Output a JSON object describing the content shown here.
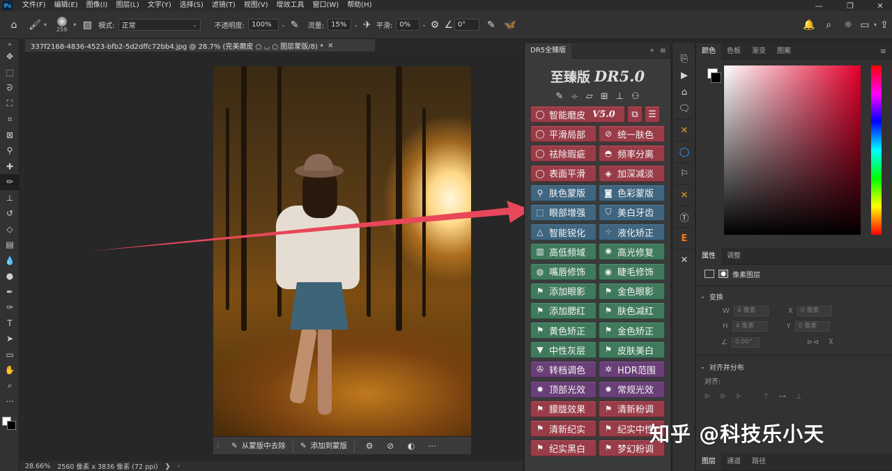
{
  "app": {
    "logo": "Ps"
  },
  "menu": [
    "文件(F)",
    "编辑(E)",
    "图像(I)",
    "图层(L)",
    "文字(Y)",
    "选择(S)",
    "滤镜(T)",
    "视图(V)",
    "增效工具",
    "窗口(W)",
    "帮助(H)"
  ],
  "options": {
    "brush_size": "259",
    "mode_label": "模式:",
    "mode_value": "正常",
    "opacity_label": "不透明度:",
    "opacity_value": "100%",
    "flow_label": "流量:",
    "flow_value": "15%",
    "smooth_label": "平滑:",
    "smooth_value": "0%",
    "angle_value": "0°"
  },
  "document": {
    "tab_title": "337f2168-4836-4523-bfb2-5d2dffc72bb4.jpg @ 28.7% (完美磨皮 ○ ◡ ○ 图层蒙版/8) *",
    "zoom": "28.66%",
    "size_info": "2560 像素 x 3836 像素 (72 ppi)"
  },
  "mask_bar": {
    "remove_label": "从蒙版中去除",
    "add_label": "添加到蒙版"
  },
  "dr5": {
    "tab_name": "DR5全臻版",
    "title_cn": "至臻版",
    "title_en": "DR5.0",
    "main_button": "智能磨皮",
    "version": "V5.0",
    "buttons": [
      [
        "平滑局部",
        "统一肤色"
      ],
      [
        "祛除瑕疵",
        "频率分离"
      ],
      [
        "表面平滑",
        "加深减淡"
      ],
      [
        "肤色蒙版",
        "色彩蒙版"
      ],
      [
        "眼部增强",
        "美白牙齿"
      ],
      [
        "智能锐化",
        "液化矫正"
      ],
      [
        "高低频域",
        "高光修复"
      ],
      [
        "嘴唇修饰",
        "睫毛修饰"
      ],
      [
        "添加眼影",
        "金色眼影"
      ],
      [
        "添加腮红",
        "肤色减红"
      ],
      [
        "黄色矫正",
        "金色矫正"
      ],
      [
        "中性灰层",
        "皮肤美白"
      ],
      [
        "转档调色",
        "HDR范围"
      ],
      [
        "顶部光效",
        "常规光效"
      ],
      [
        "朦胧效果",
        "清新粉调"
      ],
      [
        "清新纪实",
        "纪实中性"
      ],
      [
        "纪实黑白",
        "梦幻粉调"
      ]
    ]
  },
  "color_panel": {
    "tabs": [
      "颜色",
      "色板",
      "渐变",
      "图案"
    ]
  },
  "props_panel": {
    "tabs": [
      "属性",
      "调整"
    ],
    "layer_type": "像素图层",
    "transform_label": "变换",
    "w_label": "W",
    "w_value": "4 像素",
    "x_label": "X",
    "x_value": "0 像素",
    "h_label": "H",
    "h_value": "4 像素",
    "y_label": "Y",
    "y_value": "0 像素",
    "angle_value": "0.00°",
    "align_label": "对齐并分布",
    "align_sub": "对齐:"
  },
  "layers_tabs": [
    "图层",
    "通道",
    "路径"
  ],
  "watermark": "知乎 @科技乐小天",
  "colors": {
    "red": "#9a3c48",
    "blue": "#3f6580",
    "green": "#3f7a5c",
    "purple": "#6a3f78",
    "arrow": "#e8475a"
  },
  "icons": {
    "dr5_top": [
      "brush-icon",
      "bandage-icon",
      "ruler-icon",
      "chip-icon",
      "stamp-icon",
      "user-icon"
    ]
  }
}
